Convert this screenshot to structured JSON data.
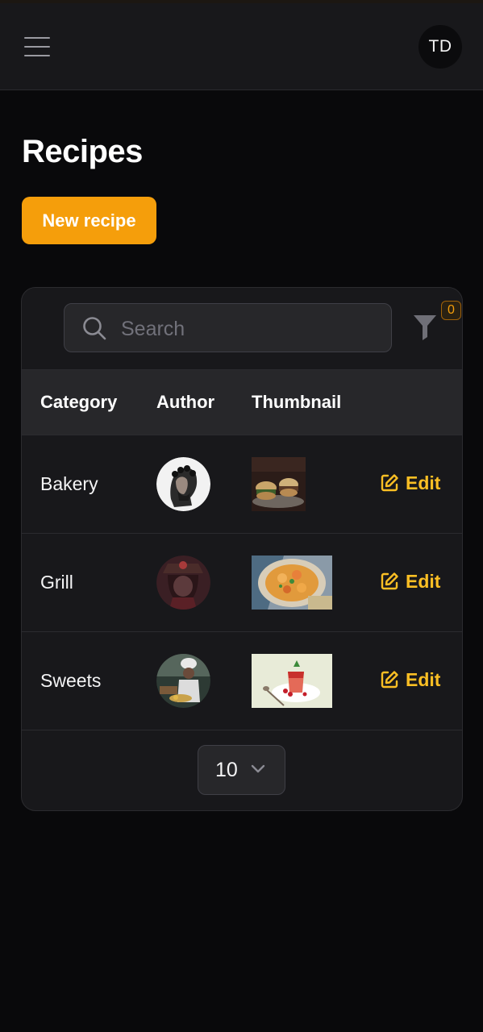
{
  "header": {
    "menu_icon": "hamburger-icon",
    "user_initials": "TD"
  },
  "page": {
    "title": "Recipes",
    "new_button_label": "New recipe"
  },
  "search": {
    "placeholder": "Search",
    "value": "",
    "icon": "search-icon"
  },
  "filter": {
    "icon": "funnel-icon",
    "count": "0"
  },
  "table": {
    "columns": [
      "Category",
      "Author",
      "Thumbnail"
    ],
    "rows": [
      {
        "category": "Bakery",
        "edit_label": "Edit"
      },
      {
        "category": "Grill",
        "edit_label": "Edit"
      },
      {
        "category": "Sweets",
        "edit_label": "Edit"
      }
    ]
  },
  "pagination": {
    "page_size": "10",
    "icon": "chevron-down-icon"
  },
  "colors": {
    "accent": "#f59e0b",
    "edit": "#fbbf24",
    "background": "#09090b",
    "surface": "#18181b",
    "header_row": "#27272a"
  }
}
